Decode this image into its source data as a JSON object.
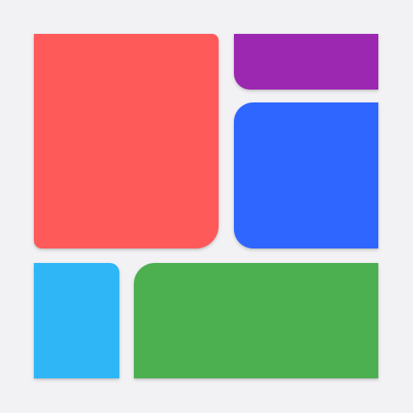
{
  "tiles": [
    {
      "name": "red-tile",
      "color": "#ff5a5a"
    },
    {
      "name": "purple-tile",
      "color": "#9c27b0"
    },
    {
      "name": "blue-tile",
      "color": "#2e66ff"
    },
    {
      "name": "light-blue-tile",
      "color": "#2fb6f7"
    },
    {
      "name": "green-tile",
      "color": "#4caf50"
    }
  ],
  "background": "#f2f2f5"
}
